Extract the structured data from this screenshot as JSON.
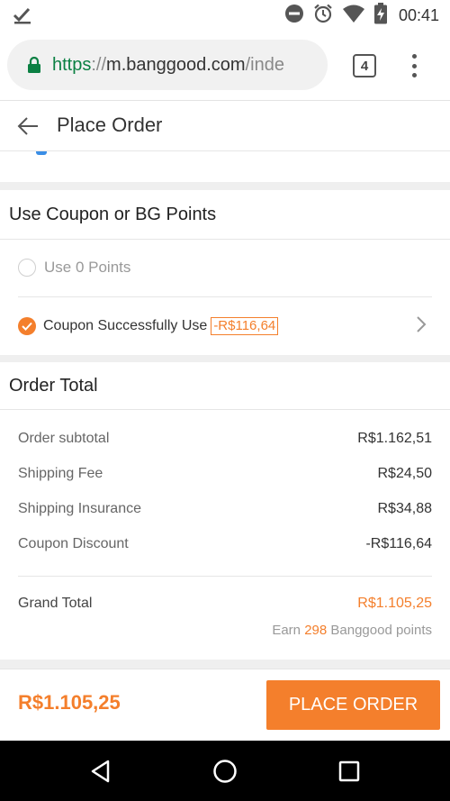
{
  "status_bar": {
    "time": "00:41",
    "icons": [
      "check-download-icon",
      "do-not-disturb-icon",
      "alarm-icon",
      "wifi-icon",
      "battery-charging-icon"
    ]
  },
  "browser": {
    "url_scheme": "https",
    "url_separator": "://",
    "url_host": "m.banggood.com",
    "url_rest": "/inde",
    "tab_count": "4",
    "secure_color": "#0b8043"
  },
  "header": {
    "title": "Place Order"
  },
  "coupon_section": {
    "title": "Use Coupon or BG Points",
    "points_option": "Use 0 Points",
    "coupon_label": "Coupon Successfully Use",
    "coupon_amount": "-R$116,64"
  },
  "order_total": {
    "title": "Order Total",
    "lines": [
      {
        "label": "Order subtotal",
        "value": "R$1.162,51"
      },
      {
        "label": "Shipping Fee",
        "value": "R$24,50"
      },
      {
        "label": "Shipping Insurance",
        "value": "R$34,88"
      },
      {
        "label": "Coupon Discount",
        "value": "-R$116,64"
      }
    ],
    "grand_total_label": "Grand Total",
    "grand_total_value": "R$1.105,25",
    "earn_prefix": "Earn",
    "earn_points": "298",
    "earn_suffix": "Banggood points"
  },
  "bottom_bar": {
    "total": "R$1.105,25",
    "place_order_label": "PLACE ORDER"
  },
  "colors": {
    "accent": "#f47f2c",
    "divider": "#e6e6e6",
    "section_gap": "#efefef"
  },
  "nav_bar": {
    "icons": [
      "back-triangle-icon",
      "home-circle-icon",
      "recents-square-icon"
    ]
  }
}
